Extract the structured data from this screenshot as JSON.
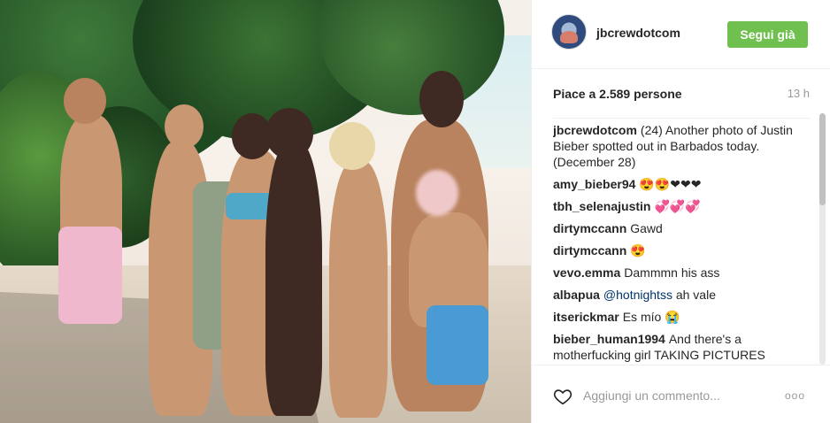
{
  "post": {
    "username": "jbcrewdotcom",
    "follow_label": "Segui già",
    "likes_text": "Piace a 2.589 persone",
    "time_ago": "13 h"
  },
  "comments": [
    {
      "user": "jbcrewdotcom",
      "text": "(24) Another photo of Justin Bieber spotted out in Barbados today. (December 28)"
    },
    {
      "user": "amy_bieber94",
      "text": "😍😍❤❤❤"
    },
    {
      "user": "tbh_selenajustin",
      "text": "💞💞💞"
    },
    {
      "user": "dirtymccann",
      "text": "Gawd"
    },
    {
      "user": "dirtymccann",
      "text": "😍"
    },
    {
      "user": "vevo.emma",
      "text": "Dammmn his ass"
    },
    {
      "user": "albapua",
      "mention": "@hotnightss",
      "text": "ah vale"
    },
    {
      "user": "itserickmar",
      "text": "Es mío 😭"
    },
    {
      "user": "bieber_human1994",
      "text": "And there's a motherfucking girl TAKING PICTURES"
    }
  ],
  "footer": {
    "comment_placeholder": "Aggiungi un commento...",
    "more_label": "ooo"
  },
  "icons": {
    "like": "heart-outline-icon",
    "more": "more-options-icon"
  },
  "colors": {
    "follow_button": "#70c050",
    "mention": "#003569"
  }
}
